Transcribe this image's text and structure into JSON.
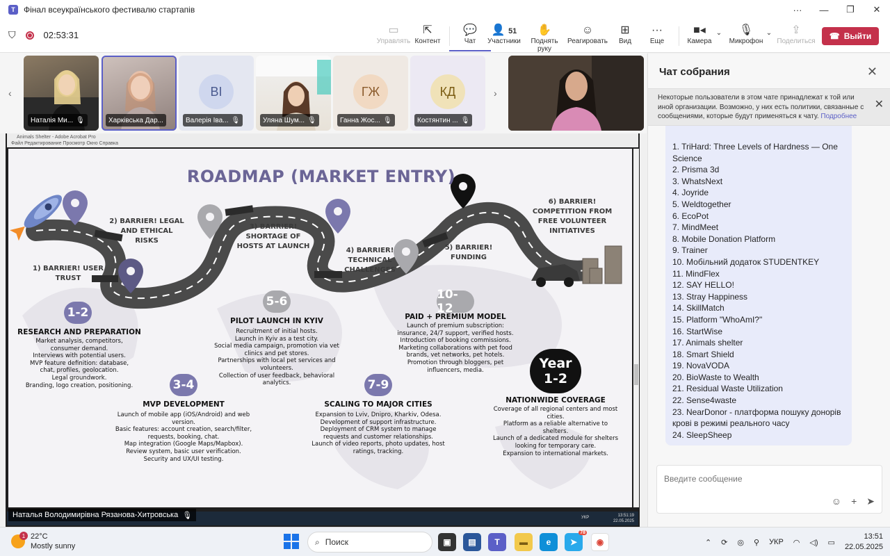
{
  "window": {
    "title": "Фінал всеукраїнського фестивалю стартапів",
    "app_icon": "T"
  },
  "toolbar": {
    "timer": "02:53:31",
    "buttons": {
      "control": "Управлять",
      "content": "Контент",
      "chat": "Чат",
      "participants": "Участники",
      "participants_count": "51",
      "raise_hand": "Поднять руку",
      "react": "Реагировать",
      "view": "Вид",
      "more": "Еще",
      "camera": "Камера",
      "mic": "Микрофон",
      "share": "Поделиться"
    },
    "leave_label": "Выйти"
  },
  "participants": [
    {
      "name": "Наталія Ми...",
      "initials": "",
      "type": "video"
    },
    {
      "name": "Харківська Дар...",
      "initials": "",
      "type": "video"
    },
    {
      "name": "Валерія Іва...",
      "initials": "ВІ",
      "type": "avatar"
    },
    {
      "name": "Уляна Шум...",
      "initials": "",
      "type": "video"
    },
    {
      "name": "Ганна Жос...",
      "initials": "ГЖ",
      "type": "avatar"
    },
    {
      "name": "Костянтин ...",
      "initials": "КД",
      "type": "avatar"
    }
  ],
  "shared_window": {
    "app_title": "Animals Shelter - Adobe Acrobat Pro",
    "menu": "Файл   Редактирование   Просмотр   Окно   Справка",
    "presenter": "Наталья Володимирівна Рязанова-Хитровська",
    "tray_lang": "УКР",
    "tray_time": "13:51:19",
    "tray_date": "22.05.2025"
  },
  "slide": {
    "title": "ROADMAP (MARKET ENTRY)",
    "barriers": [
      "1) BARRIER! USER TRUST",
      "2) BARRIER! LEGAL AND ETHICAL RISKS",
      "3) BARRIER! SHORTAGE OF HOSTS AT LAUNCH",
      "4) BARRIER! TECHNICAL CHALLENGES",
      "5) BARRIER! FUNDING",
      "6) BARRIER! COMPETITION FROM FREE VOLUNTEER INITIATIVES"
    ],
    "phases": [
      {
        "badge": "1-2",
        "heading": "RESEARCH AND PREPARATION",
        "body": "Market analysis, competitors, consumer demand.\nInterviews with potential users.\nMVP feature definition: database, chat, profiles, geolocation.\nLegal groundwork.\nBranding, logo creation, positioning."
      },
      {
        "badge": "3-4",
        "heading": "MVP DEVELOPMENT",
        "body": "Launch of mobile app (iOS/Android) and web version.\nBasic features: account creation, search/filter, requests, booking, chat.\nMap integration (Google Maps/Mapbox).\nReview system, basic user verification.\nSecurity and UX/UI testing."
      },
      {
        "badge": "5-6",
        "heading": "PILOT LAUNCH IN KYIV",
        "body": "Recruitment of initial hosts.\nLaunch in Kyiv as a test city.\nSocial media campaign, promotion via vet clinics and pet stores.\nPartnerships with local pet services and volunteers.\nCollection of user feedback, behavioral analytics."
      },
      {
        "badge": "7-9",
        "heading": "SCALING TO MAJOR CITIES",
        "body": "Expansion to Lviv, Dnipro, Kharkiv, Odesa.\nDevelopment of support infrastructure.\nDeployment of CRM system to manage requests and customer relationships.\nLaunch of video reports, photo updates, host ratings, tracking."
      },
      {
        "badge": "10-12",
        "heading": "PAID + PREMIUM MODEL",
        "body": "Launch of premium subscription: insurance, 24/7 support, verified hosts.\nIntroduction of booking commissions.\nMarketing collaborations with pet food brands, vet networks, pet hotels.\nPromotion through bloggers, pet influencers, media."
      },
      {
        "badge": "Year\n1-2",
        "heading": "NATIONWIDE COVERAGE",
        "body": "Coverage of all regional centers and most cities.\nPlatform as a reliable alternative to shelters.\nLaunch of a dedicated module for shelters looking for temporary care.\nExpansion to international markets."
      }
    ]
  },
  "chat": {
    "title": "Чат собрания",
    "notice": "Некоторые пользователи в этом чате принадлежат к той или иной организации. Возможно, у них есть политики, связанные с сообщениями, которые будут применяться к чату.",
    "notice_more": "Подробнее",
    "messages": [
      "1. TriHard: Three Levels of Hardness — One Science",
      "2. Prisma 3d",
      "3. WhatsNext",
      "4. Joyride",
      "5. Weldtogether",
      "6. EcoPot",
      "7. MindMeet",
      "8. Mobile Donation Platform",
      "9. Trainer",
      "10. Мобільний додаток STUDENTKEY",
      "11. MindFlex",
      "12. SAY HELLO!",
      "13. Stray Happiness",
      "14. SkillMatch",
      "15. Platform \"WhoAmI?\"",
      "16. StartWise",
      "17. Animals shelter",
      "18. Smart Shield",
      "19. NovaVODA",
      "20. BioWaste to Wealth",
      "21. Residual Waste Utilization",
      "22. Sense4waste",
      "23. NearDonor - платформа пошуку донорів крові в режимі реального часу",
      "24. SleepSheep"
    ],
    "input_placeholder": "Введите сообщение"
  },
  "taskbar": {
    "weather_temp": "22°C",
    "weather_desc": "Mostly sunny",
    "weather_badge": "1",
    "search_label": "Поиск",
    "lang": "УКР",
    "time": "13:51",
    "date": "22.05.2025",
    "telegram_badge": "78"
  },
  "colors": {
    "accent": "#5b5fc7",
    "leave": "#c4314b",
    "road": "#4a4a4a",
    "pin_purple": "#7b78ad",
    "pin_grey": "#a9a9ad",
    "badge_grey": "#a9a9ad"
  }
}
